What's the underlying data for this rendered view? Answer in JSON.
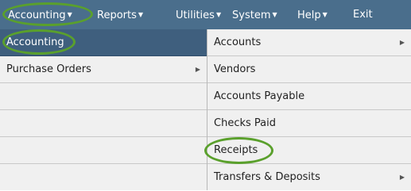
{
  "menubar": {
    "items": [
      {
        "label": "Accounting"
      },
      {
        "label": "Reports"
      },
      {
        "label": "Utilities"
      },
      {
        "label": "System"
      },
      {
        "label": "Help"
      },
      {
        "label": "Exit"
      }
    ],
    "dropdown_icon": "triangle-down-icon"
  },
  "left_menu": {
    "items": [
      {
        "label": "Accounting"
      },
      {
        "label": "Purchase Orders"
      }
    ]
  },
  "right_menu": {
    "items": [
      {
        "label": "Accounts"
      },
      {
        "label": "Vendors"
      },
      {
        "label": "Accounts Payable"
      },
      {
        "label": "Checks Paid"
      },
      {
        "label": "Receipts"
      },
      {
        "label": "Transfers & Deposits"
      }
    ],
    "submenu_icon": "chevron-right-icon"
  },
  "colors": {
    "menubar_bg": "#4a6e8c",
    "selected_bg": "#3f5f7e",
    "panel_bg": "#f0f0f0",
    "highlight_ring": "#5aa02c"
  }
}
